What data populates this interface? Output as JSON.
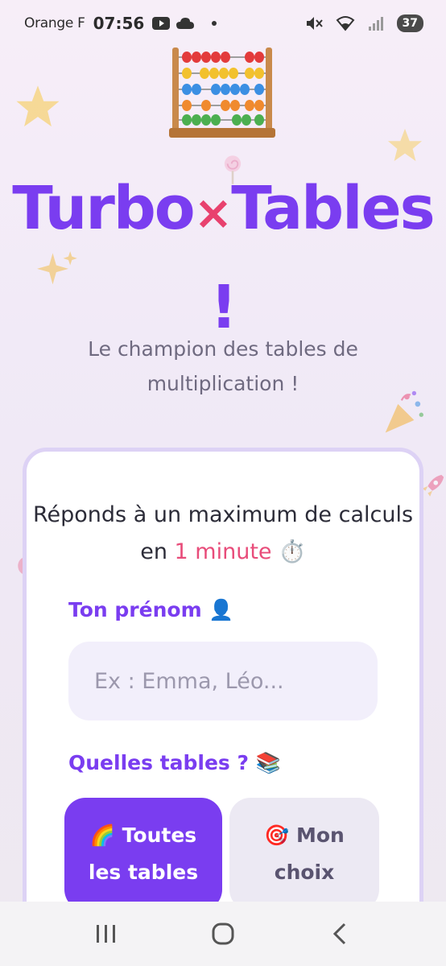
{
  "status_bar": {
    "carrier": "Orange F",
    "time": "07:56",
    "battery": "37",
    "icons": [
      "youtube-icon",
      "cloud-icon",
      "mute-icon",
      "wifi-icon",
      "signal-icon"
    ]
  },
  "header": {
    "title_part1": "Turbo",
    "title_x": "×",
    "title_part2": "Tables",
    "title_bang": "!",
    "subtitle": "Le champion des tables de multiplication !"
  },
  "card": {
    "intro_before": "Réponds à un maximum de calculs en ",
    "intro_accent": "1 minute",
    "intro_emoji": "⏱️",
    "name_label": "Ton prénom 👤",
    "name_placeholder": "Ex : Emma, Léo...",
    "tables_label": "Quelles tables ? 📚",
    "choices": [
      {
        "label": "🌈 Toutes les tables",
        "selected": true
      },
      {
        "label": "🎯 Mon choix",
        "selected": false
      }
    ]
  },
  "decorations": [
    "abacus-icon",
    "star-icon",
    "star-icon",
    "sparkles-icon",
    "lollipop-icon",
    "party-popper-icon",
    "rocket-icon"
  ],
  "colors": {
    "primary": "#7a3df0",
    "accent": "#e84c7a",
    "card_border": "#ddd2f5"
  }
}
